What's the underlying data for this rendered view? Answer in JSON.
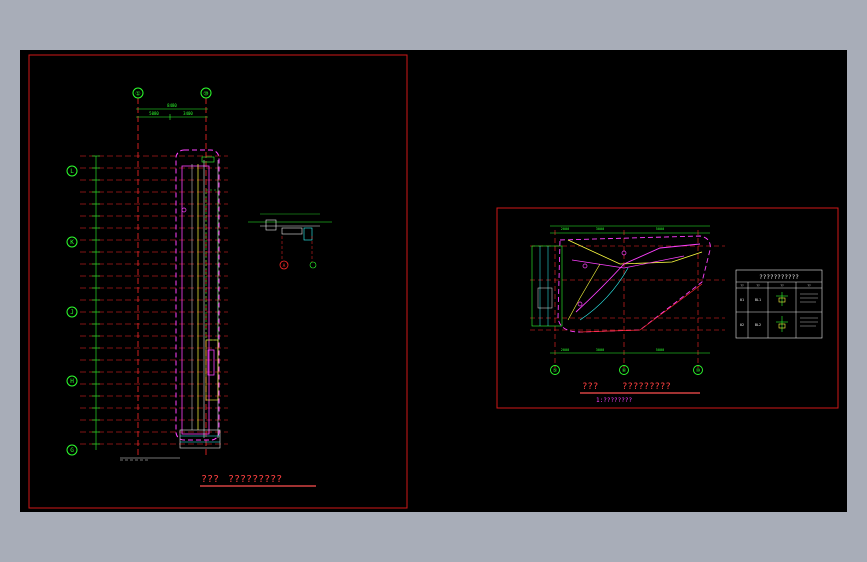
{
  "colors": {
    "background": "#000000",
    "frame_border": "#a8adb8",
    "sheet_border": "#d01818",
    "grid_line": "#ff2a2a",
    "wall_line": "#e8e8e8",
    "magenta": "#ff40ff",
    "green": "#2dff2d",
    "yellow": "#ffff40",
    "cyan": "#30ffff",
    "title_text": "#ff4040",
    "title_underline": "#ff5050"
  },
  "sheet_left": {
    "axis_top": [
      "①",
      "⑩"
    ],
    "axis_left": [
      "L",
      "K",
      "J",
      "H",
      "G"
    ],
    "top_dims": [
      "8480",
      "5080",
      "3400"
    ],
    "title_prefix": "???",
    "title_main": "?????????",
    "detail_marker": "A"
  },
  "sheet_right": {
    "axis_bottom": [
      "⑤",
      "⑥",
      "⑩"
    ],
    "bottom_dims": [
      "2000",
      "3000",
      "5000"
    ],
    "top_dims": [
      "2000",
      "3000",
      "5000"
    ],
    "title_prefix": "???",
    "title_main": "?????????",
    "title_sub": "1:????????",
    "legend": {
      "title": "???????????",
      "headers": [
        "??",
        "??",
        "??",
        "??"
      ],
      "rows": [
        {
          "no": "01",
          "code": "BL1",
          "note": ""
        },
        {
          "no": "02",
          "code": "BL2",
          "note": ""
        }
      ]
    }
  }
}
